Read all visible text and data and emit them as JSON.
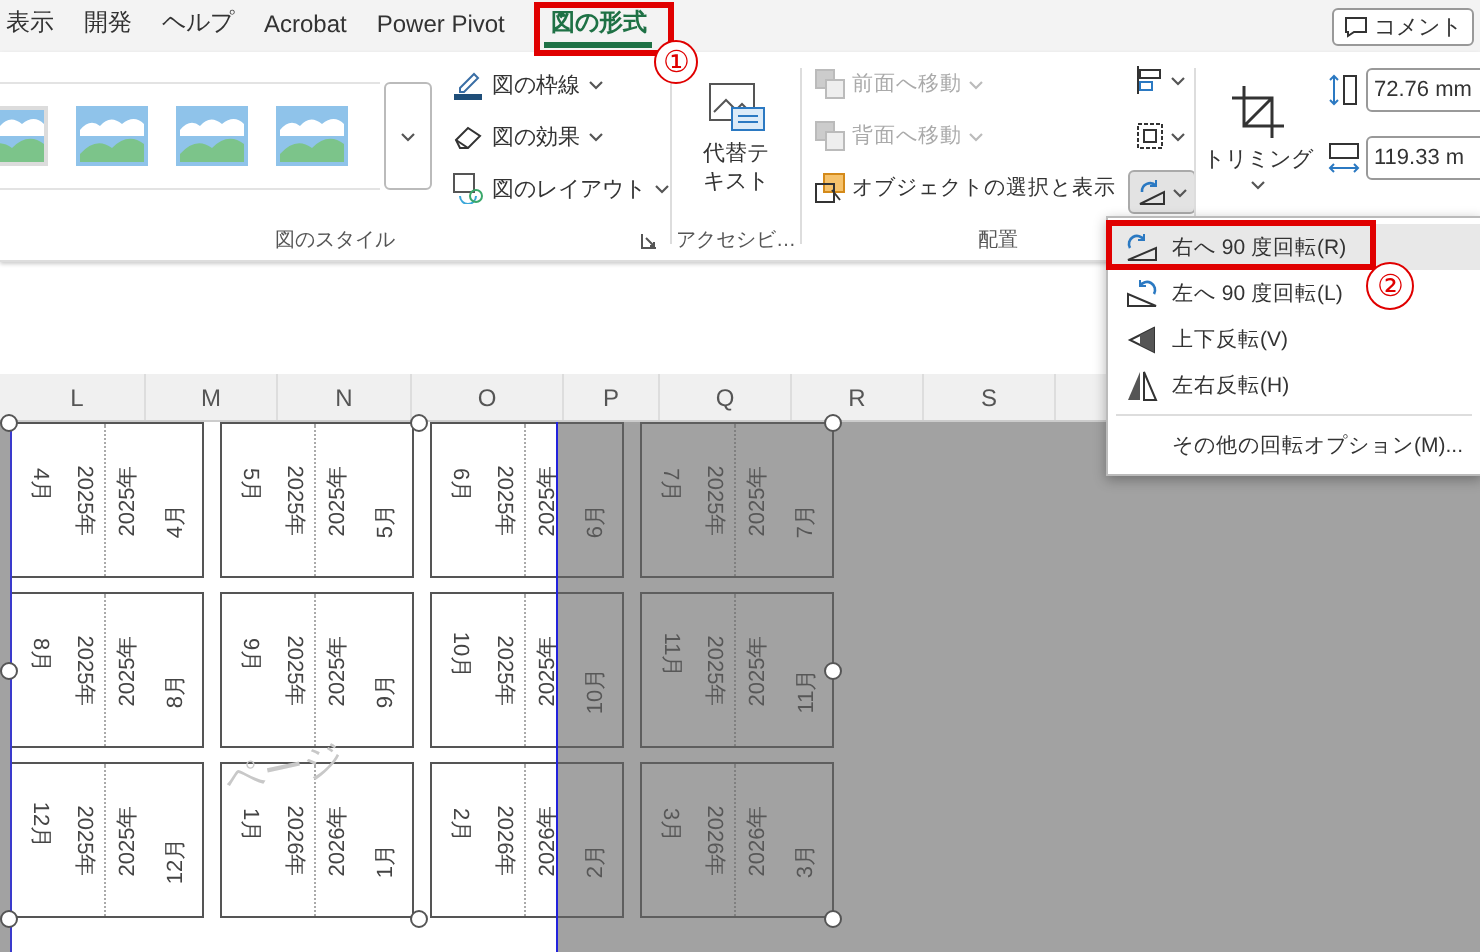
{
  "tabs": [
    {
      "label": "表示",
      "selected": false
    },
    {
      "label": "開発",
      "selected": false
    },
    {
      "label": "ヘルプ",
      "selected": false
    },
    {
      "label": "Acrobat",
      "selected": false
    },
    {
      "label": "Power Pivot",
      "selected": false
    },
    {
      "label": "図の形式",
      "selected": true
    }
  ],
  "comment_button": "コメント",
  "picture_styles": {
    "label": "図のスタイル",
    "commands": [
      {
        "label": "図の枠線"
      },
      {
        "label": "図の効果"
      },
      {
        "label": "図のレイアウト"
      }
    ]
  },
  "accessibility": {
    "button": "代替テキスト",
    "label": "アクセシビ…"
  },
  "arrange": {
    "label": "配置",
    "items": [
      {
        "label": "前面へ移動",
        "disabled": true
      },
      {
        "label": "背面へ移動",
        "disabled": true
      },
      {
        "label": "オブジェクトの選択と表示",
        "disabled": false
      }
    ]
  },
  "size": {
    "crop_label": "トリミング",
    "height": "72.76 mm",
    "width": "119.33 m"
  },
  "rotate_menu": [
    {
      "kind": "rotate-right",
      "label": "右へ 90 度回転(R)",
      "selected": true
    },
    {
      "kind": "rotate-left",
      "label": "左へ 90 度回転(L)",
      "selected": false
    },
    {
      "kind": "flip-vertical",
      "label": "上下反転(V)",
      "selected": false
    },
    {
      "kind": "flip-horizontal",
      "label": "左右反転(H)",
      "selected": false
    },
    {
      "kind": "more",
      "label": "その他の回転オプション(M)...",
      "selected": false
    }
  ],
  "annotations": [
    {
      "number": "①"
    },
    {
      "number": "②"
    }
  ],
  "sheet": {
    "columns": [
      "L",
      "M",
      "N",
      "O",
      "P",
      "Q",
      "R",
      "S"
    ],
    "page_label": "ページ",
    "cards": [
      {
        "left_month": "4月",
        "left_year": "2025年",
        "right_year": "2025年",
        "right_month": "4月"
      },
      {
        "left_month": "5月",
        "left_year": "2025年",
        "right_year": "2025年",
        "right_month": "5月"
      },
      {
        "left_month": "6月",
        "left_year": "2025年",
        "right_year": "2025年",
        "right_month": "6月"
      },
      {
        "left_month": "7月",
        "left_year": "2025年",
        "right_year": "2025年",
        "right_month": "7月"
      },
      {
        "left_month": "8月",
        "left_year": "2025年",
        "right_year": "2025年",
        "right_month": "8月"
      },
      {
        "left_month": "9月",
        "left_year": "2025年",
        "right_year": "2025年",
        "right_month": "9月"
      },
      {
        "left_month": "10月",
        "left_year": "2025年",
        "right_year": "2025年",
        "right_month": "10月"
      },
      {
        "left_month": "11月",
        "left_year": "2025年",
        "right_year": "2025年",
        "right_month": "11月"
      },
      {
        "left_month": "12月",
        "left_year": "2025年",
        "right_year": "2025年",
        "right_month": "12月"
      },
      {
        "left_month": "1月",
        "left_year": "2026年",
        "right_year": "2026年",
        "right_month": "1月"
      },
      {
        "left_month": "2月",
        "left_year": "2026年",
        "right_year": "2026年",
        "right_month": "2月"
      },
      {
        "left_month": "3月",
        "left_year": "2026年",
        "right_year": "2026年",
        "right_month": "3月"
      }
    ]
  }
}
